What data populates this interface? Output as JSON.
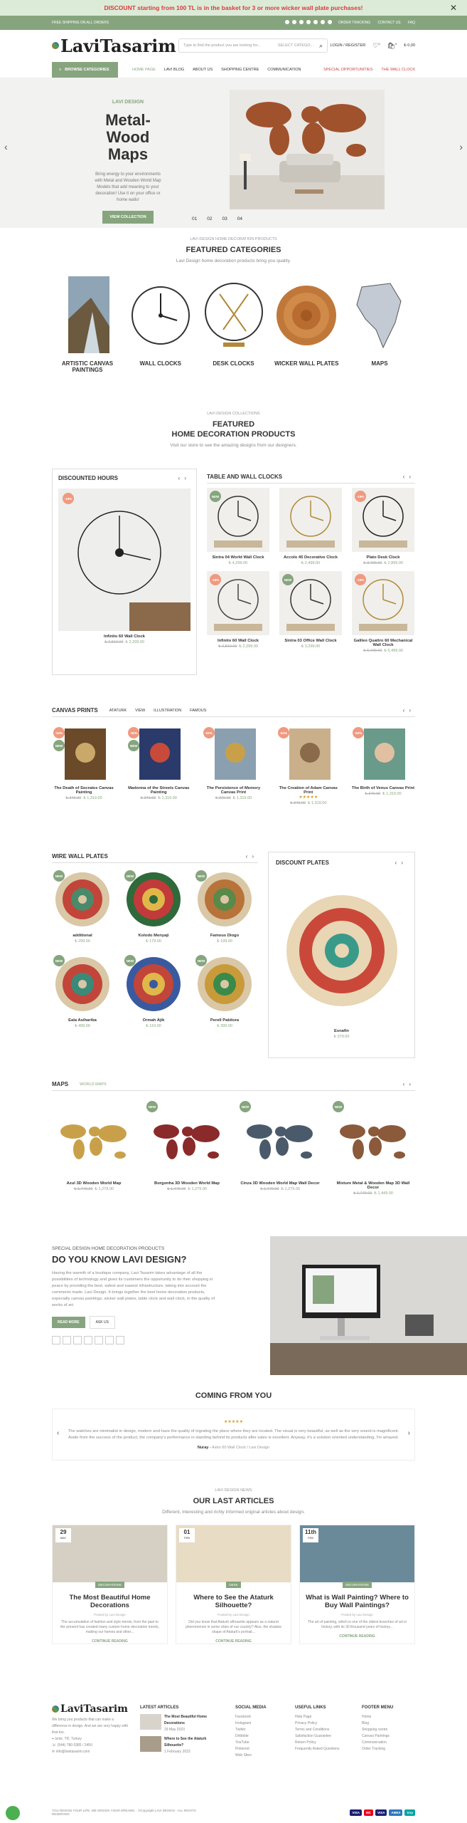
{
  "topbar": {
    "message": "DISCOUNT starting from 100 TL is in the basket for 3 or more wicker wall plate purchases!",
    "close": "✕"
  },
  "greenbar": {
    "left": "FREE SHIPPING ON ALL ORDERS",
    "links": [
      "ORDER TRACKING",
      "CONTACT US",
      "FAQ"
    ]
  },
  "header": {
    "logo": "LaviTasarim",
    "search_placeholder": "Type to find the product you are looking for...",
    "category_select": "SELECT CATEGO...",
    "login": "LOGIN / REGISTER",
    "wishlist_count": "0",
    "cart_count": "0",
    "cart_total": "₺ 0,00"
  },
  "nav": {
    "category_btn": "BROWSE CATEGORIES",
    "items": [
      "HOME PAGE",
      "LAVI BLOG",
      "ABOUT US",
      "SHOPPING CENTRE",
      "COMMUNICATION"
    ],
    "special": "SPECIAL OPPORTUNITIES",
    "wall": "THE WALL CLOCK"
  },
  "hero": {
    "subtitle": "LAVI DESIGN",
    "title": "Metal-Wood Maps",
    "desc": "Bring energy to your environments with Metal and Wooden World Map Models that add meaning to your decoration! Use it on your office or home walls!",
    "button": "VIEW COLLECTION",
    "dots": [
      "01",
      "02",
      "03",
      "04"
    ]
  },
  "featured": {
    "sub": "LAVI DESIGN HOME DECORATION PRODUCTS",
    "title": "FEATURED CATEGORIES",
    "desc": "Lavi Design home decoration products bring you quality.",
    "cats": [
      "ARTISTIC CANVAS PAINTINGS",
      "WALL CLOCKS",
      "DESK CLOCKS",
      "WICKER WALL PLATES",
      "MAPS"
    ]
  },
  "products_sec": {
    "sub": "LAVI DESIGN COLLECTIONS",
    "title1": "FEATURED",
    "title2": "HOME DECORATION PRODUCTS",
    "desc": "Visit our store to see the amazing designs from our designers."
  },
  "discounted": {
    "title": "DISCOUNTED HOURS",
    "name": "Infinito 60 Wall Clock",
    "old": "₺ 2,810.00",
    "price": "₺ 2,299.00"
  },
  "table_clocks": {
    "title": "TABLE AND WALL CLOCKS",
    "items": [
      {
        "name": "Sintra 04 World Wall Clock",
        "old": "",
        "price": "₺ 4,299.00",
        "tag": "NEW"
      },
      {
        "name": "Accolo 45 Decorative Clock",
        "old": "",
        "price": "₺ 2,499.00",
        "tag": ""
      },
      {
        "name": "Plato Desk Clock",
        "old": "₺ 3,499.00",
        "price": "₺ 2,899.00",
        "tag": "-16%"
      },
      {
        "name": "Infinito 60 Wall Clock",
        "old": "₺ 2,810.00",
        "price": "₺ 2,299.00",
        "tag": "-18%"
      },
      {
        "name": "Sintra 03 Office Wall Clock",
        "old": "",
        "price": "₺ 3,299.00",
        "tag": "NEW"
      },
      {
        "name": "Galileo Quattro 60 Mechanical Wall Clock",
        "old": "₺ 6,499.00",
        "price": "₺ 5,499.00",
        "tag": "-15%"
      }
    ]
  },
  "canvas": {
    "title": "CANVAS PRINTS",
    "tabs": [
      "ATATURK",
      "VIEW",
      "ILLUSTRATION",
      "FAMOUS"
    ],
    "items": [
      {
        "name": "The Death of Socrates Canvas Painting",
        "old": "₺ 349.00",
        "price": "₺ 1,319.00"
      },
      {
        "name": "Madonna of the Streets Canvas Painting",
        "old": "₺ 349.00",
        "price": "₺ 1,319.00"
      },
      {
        "name": "The Persistence of Memory Canvas Print",
        "old": "₺ 349.00",
        "price": "₺ 1,319.00"
      },
      {
        "name": "The Creation of Adam Canvas Print",
        "old": "₺ 349.00",
        "price": "₺ 1,319.00"
      },
      {
        "name": "The Birth of Venus Canvas Print",
        "old": "₺ 349.00",
        "price": "₺ 1,319.00"
      }
    ]
  },
  "wire": {
    "title": "WIRE WALL PLATES",
    "items": [
      {
        "name": "additional",
        "price": "₺ 299.00"
      },
      {
        "name": "Kolodo Menyaji",
        "price": "₺ 179.00"
      },
      {
        "name": "Famous Diogo",
        "price": "₺ 199.00"
      },
      {
        "name": "Eala Asihariba",
        "price": "₺ 499.00"
      },
      {
        "name": "Ormah Ajik",
        "price": "₺ 119.00"
      },
      {
        "name": "Perell Pakitora",
        "price": "₺ 399.00"
      }
    ],
    "discount_title": "DISCOUNT PLATES",
    "discount_name": "Esnafin",
    "discount_price": "₺ 379.00"
  },
  "maps": {
    "title": "MAPS",
    "tab": "WORLD MAPS",
    "items": [
      {
        "name": "Azul 3D Wooden World Map",
        "old": "₺ 1,479.00",
        "price": "₺ 1,279.00"
      },
      {
        "name": "Borgonha 3D Wooden World Map",
        "old": "₺ 1,479.00",
        "price": "₺ 1,279.00"
      },
      {
        "name": "Cinza 3D Wooden World Map Wall Decor",
        "old": "₺ 1,479.00",
        "price": "₺ 1,279.00"
      },
      {
        "name": "Mixture Metal & Wooden Map 3D Wall Decor",
        "old": "₺ 1,749.00",
        "price": "₺ 1,449.00"
      }
    ]
  },
  "about": {
    "sub": "SPECIAL DESIGN HOME DECORATION PRODUCTS",
    "title": "DO YOU KNOW LAVI DESIGN?",
    "p1": "Having the warmth of a boutique company, Lavi Tasarim takes advantage of all the possibilities of technology and gives its customers the opportunity to do their shopping in peace by providing the best, safest and easiest infrastructure, taking into account the comments made. Lavi Design, It brings together the best home decoration products, especially canvas paintings, wicker wall plates, table clock and wall clock, in the quality of works of art.",
    "read": "READ MORE",
    "ask": "ASK US"
  },
  "testimonial": {
    "title": "COMING FROM YOU",
    "stars": "★★★★★",
    "text": "The watches are minimalist in design, modern and have the quality of ingrating the place where they are located. The visual is very beautiful, as well as the very sound is magnificent. Aside from the success of the product, the company's performance in standing behind its products after sales is excellent. Anyway, it's a solution oriented understanding, I'm amazed.",
    "author": "Nuray",
    "product": "Astro 60 Wall Clock / Lavi Design"
  },
  "articles": {
    "sub": "LAVI DESIGN NEWS",
    "title": "OUR LAST ARTICLES",
    "desc": "Different, interesting and richly informed original articles about design.",
    "items": [
      {
        "day": "29",
        "month": "MAY",
        "cat": "DECORATIONS",
        "title": "The Most Beautiful Home Decorations",
        "meta": "Posted by Lavi Design",
        "text": "The accumulation of fashion and style trends, from the past to the present has created many custom home decoration trends, making our homes and other...",
        "more": "CONTINUE READING"
      },
      {
        "day": "01",
        "month": "FEB",
        "cat": "DESK",
        "title": "Where to See the Ataturk Silhouette?",
        "meta": "Posted by Lavi Design",
        "text": "Did you know that Ataturk silhouette appears as a natural phenomenon in some cities of our country? Also, the shadow shape of Ataturk's portrait...",
        "more": "CONTINUE READING"
      },
      {
        "day": "11th",
        "month": "FEB",
        "cat": "DECORATIONS",
        "title": "What is Wall Painting? Where to Buy Wall Paintings?",
        "meta": "Posted by Lavi Design",
        "text": "The art of painting, which is one of the oldest branches of art in history, with its 30 thousand years of history...",
        "more": "CONTINUE READING"
      }
    ]
  },
  "footer": {
    "logo": "LaviTasarim",
    "about": "We bring you products that can make a difference in design. And we are very happy with that too.",
    "address": "Izmir, TR, Turkey",
    "phone": "(544) 780 0385 / 2450",
    "email": "info@lavitasarim.com",
    "latest_title": "LATEST ARTICLES",
    "latest": [
      {
        "t": "The Most Beautiful Home Decorations",
        "d": "29 May 2023"
      },
      {
        "t": "Where to See the Ataturk Silhouette?",
        "d": "1 February 2023"
      }
    ],
    "social_title": "SOCIAL MEDIA",
    "social": [
      "Facebook",
      "Instagram",
      "Twitter",
      "Dribbble",
      "YouTube",
      "Pinterest",
      "Web Sites"
    ],
    "useful_title": "USEFUL LINKS",
    "useful": [
      "Help Page",
      "Privacy Policy",
      "Terms and Conditions",
      "Satisfaction Guarantee",
      "Return Policy",
      "Frequently Asked Questions"
    ],
    "menu_title": "FOOTER MENU",
    "menu": [
      "Home",
      "Blog",
      "Shopping centre",
      "Canvas Paintings",
      "Communication",
      "Order Tracking"
    ],
    "copyright": "YOU DESIGN YOUR LIFE, WE DESIGN YOUR DREAMS... ©Copyright LAVI DESIGN - ALL RIGHTS RESERVED",
    "payments": [
      "VISA",
      "MC",
      "VISA",
      "AMEX",
      "troy"
    ]
  }
}
